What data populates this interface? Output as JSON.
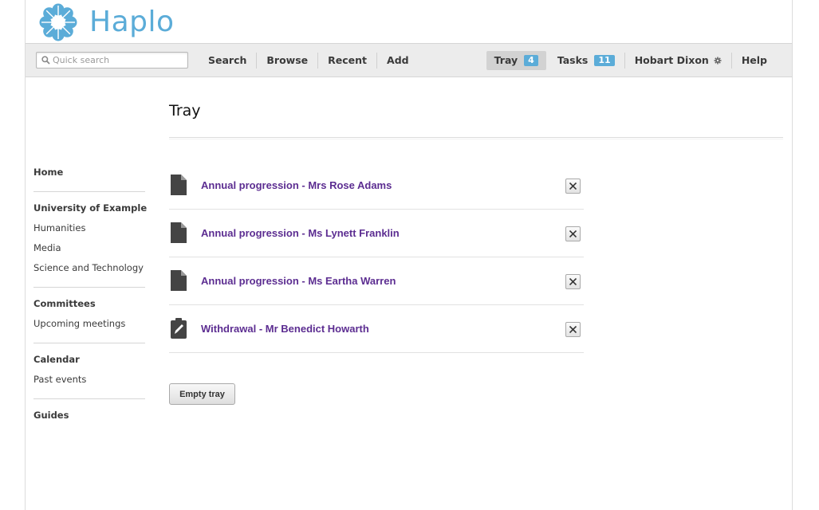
{
  "app": {
    "logo_text": "Haplo",
    "logo_icon": "flower-logo-icon",
    "accent_color": "#5bacd8",
    "link_color": "#5c2d91"
  },
  "toolbar": {
    "search_placeholder": "Quick search",
    "nav_left": [
      "Search",
      "Browse",
      "Recent",
      "Add"
    ],
    "tray_label": "Tray",
    "tray_count": "4",
    "tasks_label": "Tasks",
    "tasks_count": "11",
    "user_name": "Hobart Dixon",
    "help_label": "Help"
  },
  "sidebar": {
    "home": "Home",
    "university": {
      "title": "University of Example",
      "items": [
        "Humanities",
        "Media",
        "Science and Technology"
      ]
    },
    "committees": {
      "title": "Committees",
      "items": [
        "Upcoming meetings"
      ]
    },
    "calendar": {
      "title": "Calendar",
      "items": [
        "Past events"
      ]
    },
    "guides": "Guides"
  },
  "main": {
    "title": "Tray",
    "items": [
      {
        "label": "Annual progression - Mrs Rose Adams",
        "icon": "document-icon"
      },
      {
        "label": "Annual progression - Ms Lynett Franklin",
        "icon": "document-icon"
      },
      {
        "label": "Annual progression - Ms Eartha Warren",
        "icon": "document-icon"
      },
      {
        "label": "Withdrawal - Mr Benedict Howarth",
        "icon": "clipboard-pencil-icon"
      }
    ],
    "empty_button": "Empty tray"
  }
}
